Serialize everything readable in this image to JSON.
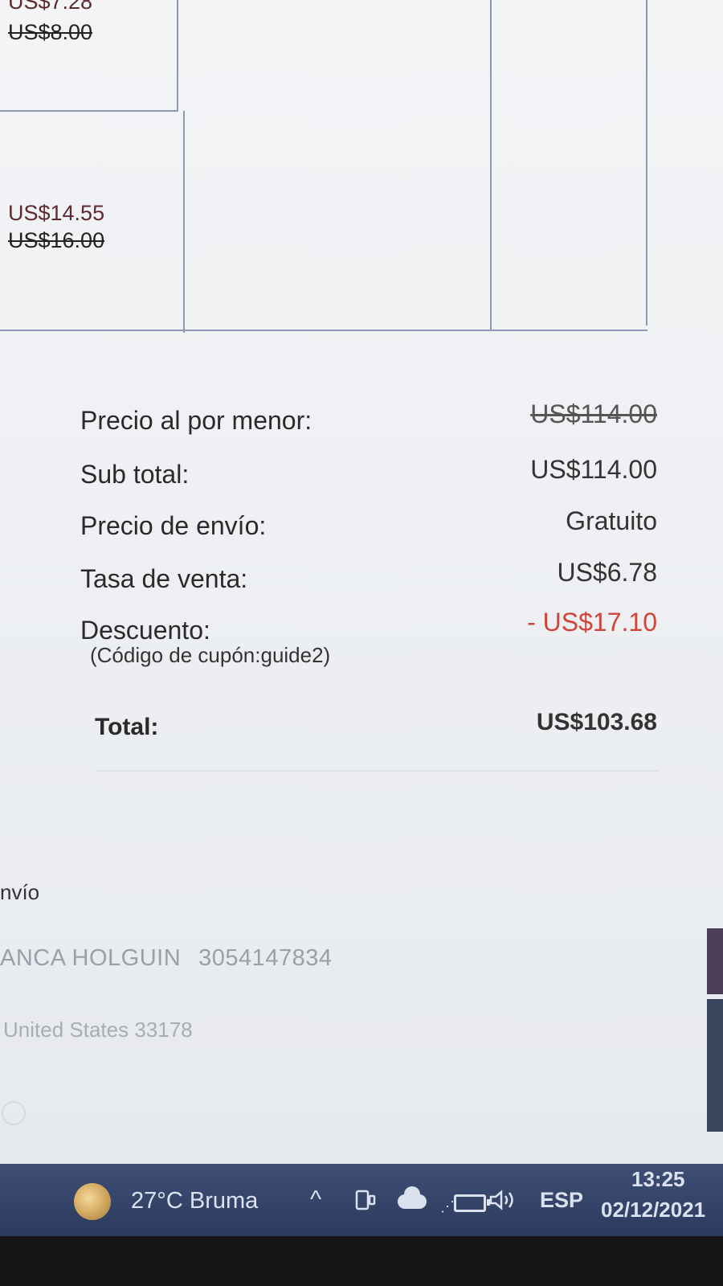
{
  "items": [
    {
      "price": "US$7.28",
      "original_price": "US$8.00"
    },
    {
      "price": "US$14.55",
      "original_price": "US$16.00"
    }
  ],
  "summary": {
    "retail_label": "Precio al por menor:",
    "retail_value": "US$114.00",
    "subtotal_label": "Sub total:",
    "subtotal_value": "US$114.00",
    "shipping_label": "Precio de envío:",
    "shipping_value": "Gratuito",
    "tax_label": "Tasa de venta:",
    "tax_value": "US$6.78",
    "discount_label": "Descuento:",
    "coupon_note": "(Código de cupón:guide2)",
    "discount_value": "- US$17.10",
    "total_label": "Total:",
    "total_value": "US$103.68"
  },
  "shipping": {
    "heading": "nvío",
    "name": "ANCA HOLGUIN",
    "phone": "3054147834",
    "address": "United States 33178"
  },
  "taskbar": {
    "weather_icon": "sun-haze-icon",
    "weather": "27°C  Bruma",
    "tray_icons": [
      "chevron-up-icon",
      "meet-now-icon",
      "onedrive-cloud-icon",
      "battery-icon",
      "volume-icon"
    ],
    "language": "ESP",
    "time": "13:25",
    "date": "02/12/2021"
  },
  "colors": {
    "discount": "#d0443a",
    "taskbar": "#33426a",
    "table_border": "#8e98b3"
  }
}
